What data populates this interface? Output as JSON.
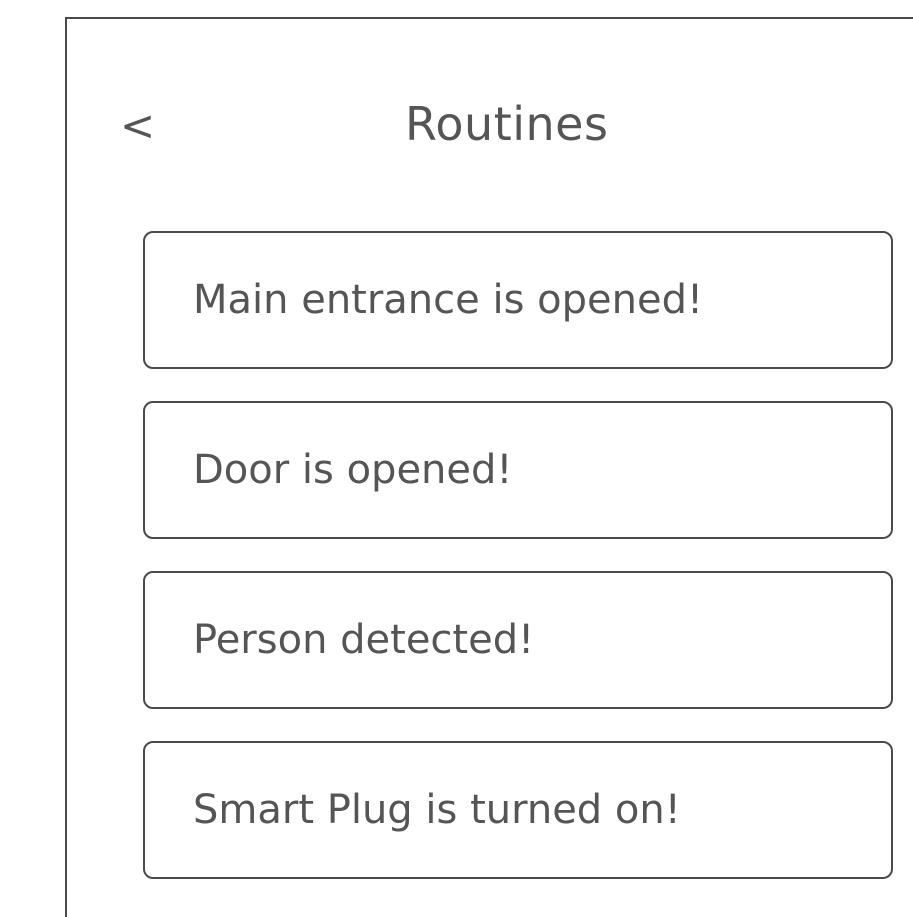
{
  "header": {
    "back_label": "<",
    "title": "Routines"
  },
  "routines": [
    {
      "label": "Main entrance is opened!"
    },
    {
      "label": "Door is opened!"
    },
    {
      "label": "Person detected!"
    },
    {
      "label": "Smart Plug is turned on!"
    }
  ]
}
